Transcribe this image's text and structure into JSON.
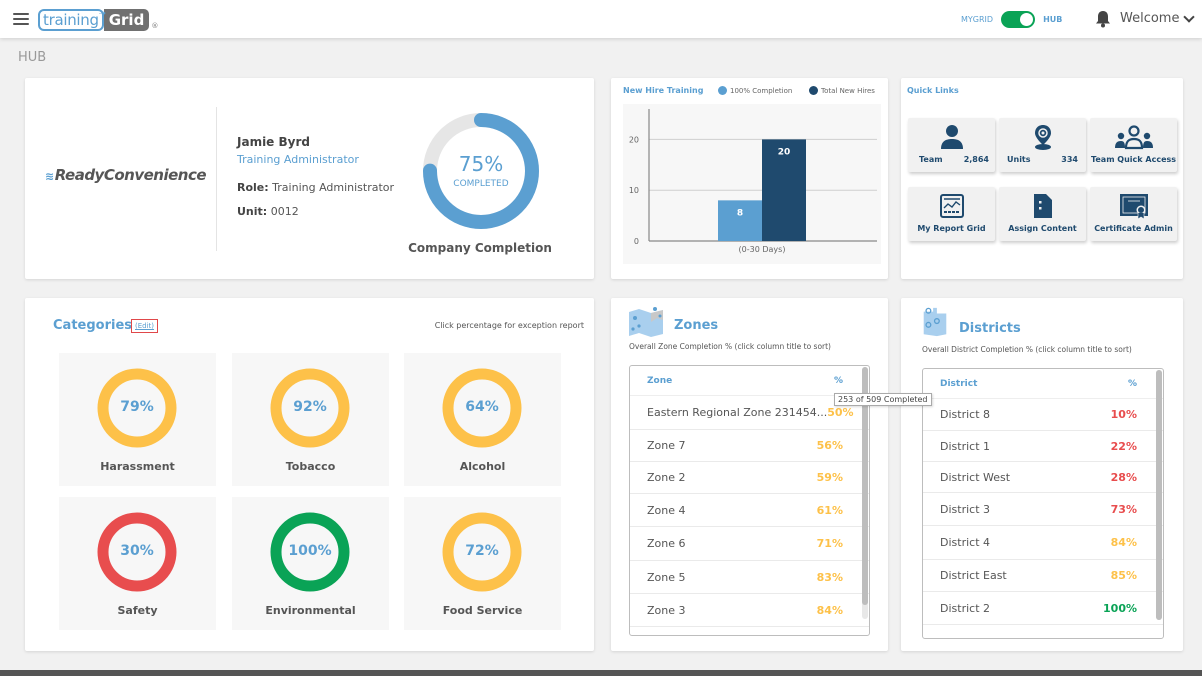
{
  "header": {
    "logo_text_1": "training",
    "logo_text_2": "Grid",
    "logo_reg": "®",
    "toggle_left": "MYGRID",
    "toggle_right": "HUB",
    "toggle_on": true,
    "welcome": "Welcome"
  },
  "page_title": "HUB",
  "profile": {
    "brand": "ReadyConvenience",
    "name": "Jamie Byrd",
    "title": "Training Administrator",
    "role_label": "Role:",
    "role_value": "Training Administrator",
    "unit_label": "Unit:",
    "unit_value": "0012",
    "completion_percent": 75,
    "completion_text": "75%",
    "completion_sub": "COMPLETED",
    "completion_label": "Company Completion"
  },
  "chart_data": {
    "type": "bar",
    "title": "New Hire Training",
    "categories": [
      "(0-30 Days)"
    ],
    "series": [
      {
        "name": "100% Completion",
        "values": [
          8
        ],
        "color": "#5b9fd1"
      },
      {
        "name": "Total New Hires",
        "values": [
          20
        ],
        "color": "#1f4a6e"
      }
    ],
    "yticks": [
      0,
      10,
      20
    ],
    "ylim": [
      0,
      25
    ],
    "grid": true,
    "legend": "top",
    "xlabel": "",
    "ylabel": ""
  },
  "quick_links": {
    "title": "Quick Links",
    "items": [
      {
        "label": "Team",
        "count": "2,864",
        "icon": "person-icon"
      },
      {
        "label": "Units",
        "count": "334",
        "icon": "location-pin-icon"
      },
      {
        "label": "Team Quick Access",
        "icon": "group-icon"
      },
      {
        "label": "My Report Grid",
        "icon": "report-chart-icon"
      },
      {
        "label": "Assign Content",
        "icon": "document-icon"
      },
      {
        "label": "Certificate Admin",
        "icon": "certificate-icon"
      }
    ]
  },
  "categories": {
    "title": "Categories",
    "edit_label": "(Edit)",
    "hint": "Click percentage for exception report",
    "items": [
      {
        "name": "Harassment",
        "value": "79%",
        "percent": 79,
        "color": "#fdc149"
      },
      {
        "name": "Tobacco",
        "value": "92%",
        "percent": 92,
        "color": "#fdc149"
      },
      {
        "name": "Alcohol",
        "value": "64%",
        "percent": 64,
        "color": "#fdc149"
      },
      {
        "name": "Safety",
        "value": "30%",
        "percent": 30,
        "color": "#e84d4e"
      },
      {
        "name": "Environmental",
        "value": "100%",
        "percent": 100,
        "color": "#0aa356"
      },
      {
        "name": "Food Service",
        "value": "72%",
        "percent": 72,
        "color": "#fdc149"
      }
    ]
  },
  "zones": {
    "title": "Zones",
    "subtitle": "Overall Zone Completion % (click column title to sort)",
    "col_name": "Zone",
    "col_pct": "%",
    "tooltip": "253 of 509 Completed",
    "rows": [
      {
        "name": "Eastern Regional Zone 231454...",
        "value": "50%",
        "color": "#fdc149"
      },
      {
        "name": "Zone 7",
        "value": "56%",
        "color": "#fdc149"
      },
      {
        "name": "Zone 2",
        "value": "59%",
        "color": "#fdc149"
      },
      {
        "name": "Zone 4",
        "value": "61%",
        "color": "#fdc149"
      },
      {
        "name": "Zone 6",
        "value": "71%",
        "color": "#fdc149"
      },
      {
        "name": "Zone 5",
        "value": "83%",
        "color": "#fdc149"
      },
      {
        "name": "Zone 3",
        "value": "84%",
        "color": "#fdc149"
      }
    ]
  },
  "districts": {
    "title": "Districts",
    "subtitle": "Overall District Completion % (click column title to sort)",
    "col_name": "District",
    "col_pct": "%",
    "rows": [
      {
        "name": "District 8",
        "value": "10%",
        "color": "#e84d4e"
      },
      {
        "name": "District 1",
        "value": "22%",
        "color": "#e84d4e"
      },
      {
        "name": "District West",
        "value": "28%",
        "color": "#e84d4e"
      },
      {
        "name": "District 3",
        "value": "73%",
        "color": "#e84d4e"
      },
      {
        "name": "District 4",
        "value": "84%",
        "color": "#fdc149"
      },
      {
        "name": "District East",
        "value": "85%",
        "color": "#fdc149"
      },
      {
        "name": "District 2",
        "value": "100%",
        "color": "#0aa356"
      }
    ]
  }
}
